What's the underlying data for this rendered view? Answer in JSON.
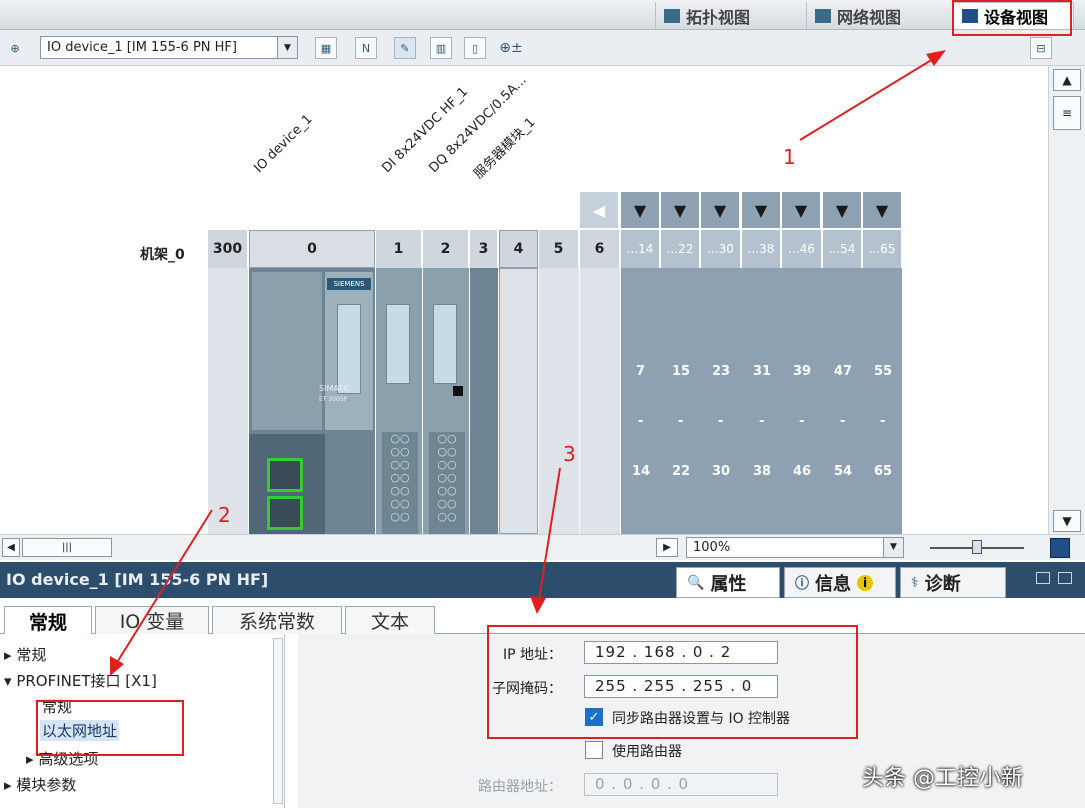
{
  "view_tabs": [
    {
      "label": "拓扑视图"
    },
    {
      "label": "网络视图"
    },
    {
      "label": "设备视图"
    }
  ],
  "toolbar": {
    "device_select": "IO device_1 [IM 155-6 PN HF]"
  },
  "canvas": {
    "modules": [
      "IO device_1",
      "DI 8x24VDC HF_1",
      "DQ 8x24VDC/0.5A...",
      "服务器模块_1"
    ],
    "rack_label": "机架_0",
    "slots": [
      "300",
      "0",
      "1",
      "2",
      "3",
      "4",
      "5",
      "6"
    ],
    "extra_slots": [
      "...14",
      "...22",
      "...30",
      "...38",
      "...46",
      "...54",
      "...65"
    ],
    "range_top": [
      "7",
      "15",
      "23",
      "31",
      "39",
      "47",
      "55"
    ],
    "range_bottom": [
      "14",
      "22",
      "30",
      "38",
      "46",
      "54",
      "65"
    ],
    "range_sep": "-",
    "siemens": "SIEMENS",
    "simatic": "SIMATIC",
    "et": "ET 200SP"
  },
  "zoom": {
    "value": "100%"
  },
  "inspector": {
    "title": "IO device_1 [IM 155-6 PN HF]",
    "tabs": [
      {
        "label": "属性"
      },
      {
        "label": "信息"
      },
      {
        "label": "诊断"
      }
    ]
  },
  "subtabs": [
    "常规",
    "IO 变量",
    "系统常数",
    "文本"
  ],
  "nav": {
    "items": [
      "常规",
      "PROFINET接口 [X1]",
      "常规",
      "以太网地址",
      "高级选项",
      "模块参数"
    ]
  },
  "fields": {
    "ip_label": "IP 地址：",
    "ip_value": "192 . 168 . 0    . 2",
    "mask_label": "子网掩码：",
    "mask_value": "255 . 255 . 255 . 0",
    "sync_label": "同步路由器设置与 IO 控制器",
    "use_router_label": "使用路由器",
    "router_label": "路由器地址：",
    "router_value": "0    . 0    . 0    . 0"
  },
  "annotations": [
    "1",
    "2",
    "3"
  ],
  "watermark": "头条 @工控小新"
}
